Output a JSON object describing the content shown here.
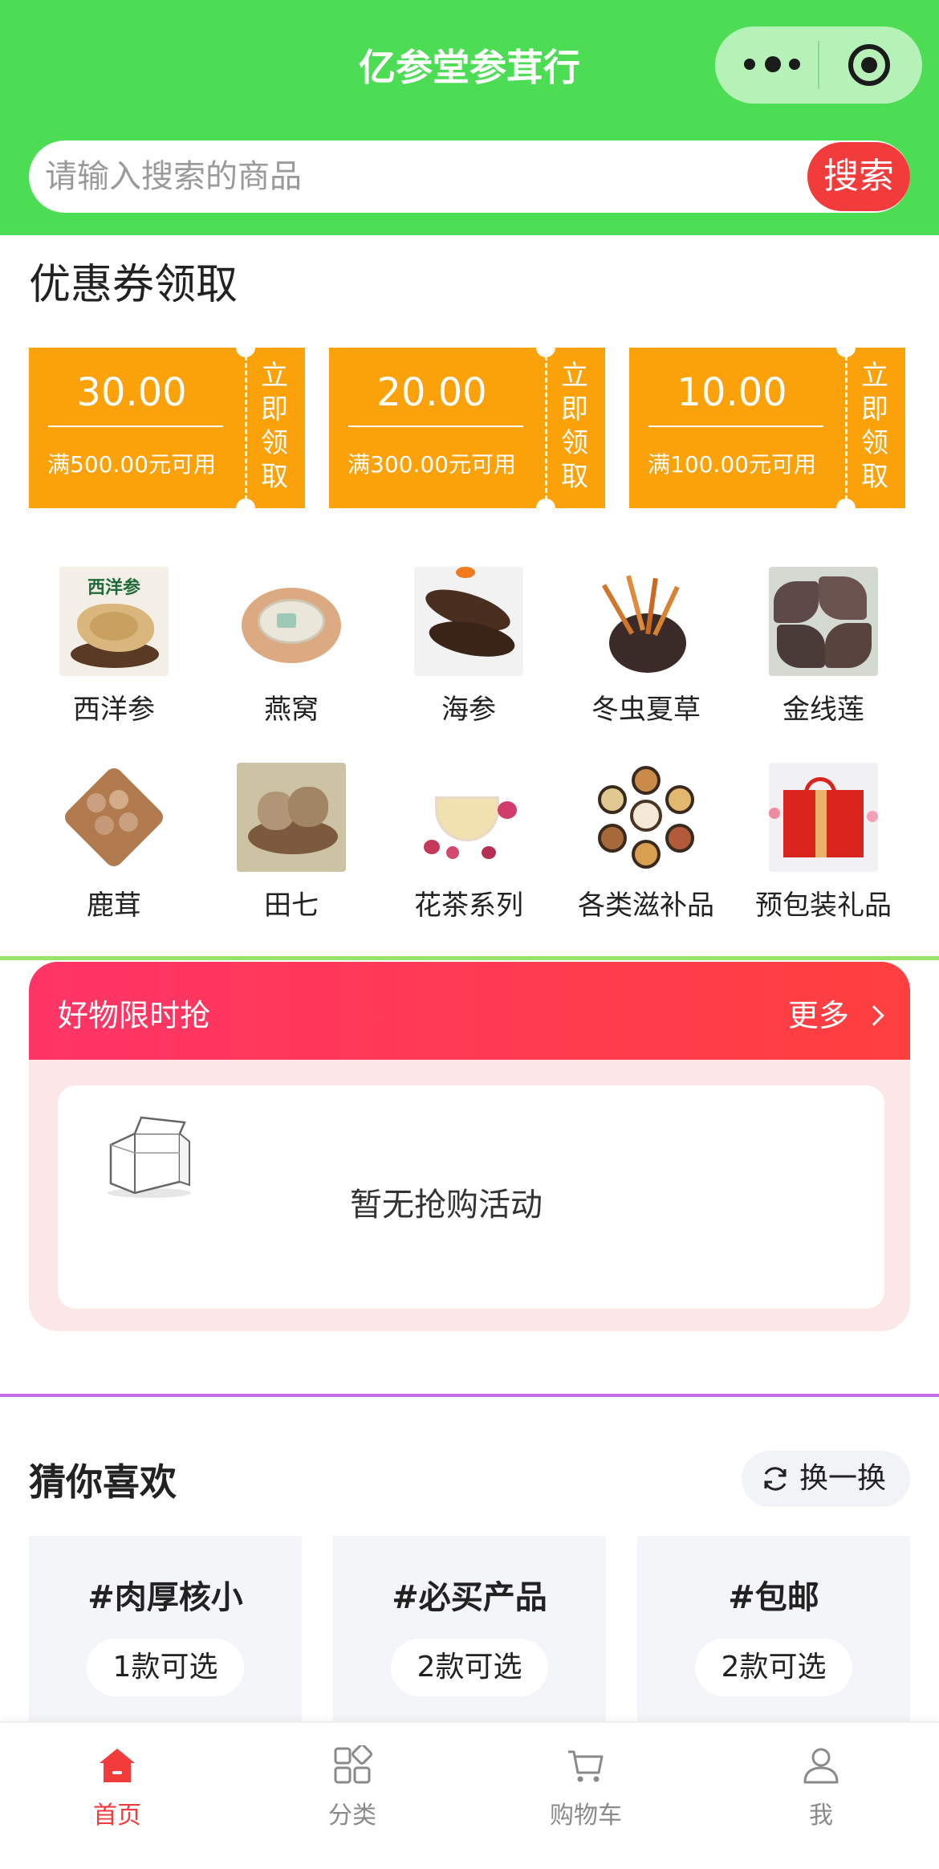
{
  "header": {
    "title": "亿参堂参茸行"
  },
  "search": {
    "placeholder": "请输入搜索的商品",
    "button": "搜索"
  },
  "coupons": {
    "title": "优惠券领取",
    "items": [
      {
        "amount": "30.00",
        "condition": "满500.00元可用",
        "claim": "立即领取"
      },
      {
        "amount": "20.00",
        "condition": "满300.00元可用",
        "claim": "立即领取"
      },
      {
        "amount": "10.00",
        "condition": "满100.00元可用",
        "claim": "立即领取"
      }
    ]
  },
  "categories": [
    {
      "label": "西洋参",
      "img_text": "西洋参"
    },
    {
      "label": "燕窝"
    },
    {
      "label": "海参"
    },
    {
      "label": "冬虫夏草"
    },
    {
      "label": "金线莲"
    },
    {
      "label": "鹿茸"
    },
    {
      "label": "田七"
    },
    {
      "label": "花茶系列"
    },
    {
      "label": "各类滋补品"
    },
    {
      "label": "预包装礼品"
    }
  ],
  "flash": {
    "title": "好物限时抢",
    "more": "更多",
    "empty": "暂无抢购活动"
  },
  "guess": {
    "title": "猜你喜欢",
    "refresh": "换一换",
    "tags": [
      {
        "tag": "#肉厚核小",
        "count": "1款可选"
      },
      {
        "tag": "#必买产品",
        "count": "2款可选"
      },
      {
        "tag": "#包邮",
        "count": "2款可选"
      }
    ]
  },
  "tabbar": [
    {
      "label": "首页",
      "icon": "home-icon",
      "active": true
    },
    {
      "label": "分类",
      "icon": "grid-icon",
      "active": false
    },
    {
      "label": "购物车",
      "icon": "cart-icon",
      "active": false
    },
    {
      "label": "我",
      "icon": "user-icon",
      "active": false
    }
  ],
  "colors": {
    "header": "#4cdd55",
    "accent": "#f23c3c",
    "coupon": "#fba10a",
    "flash_gradient_start": "#ff3567"
  }
}
